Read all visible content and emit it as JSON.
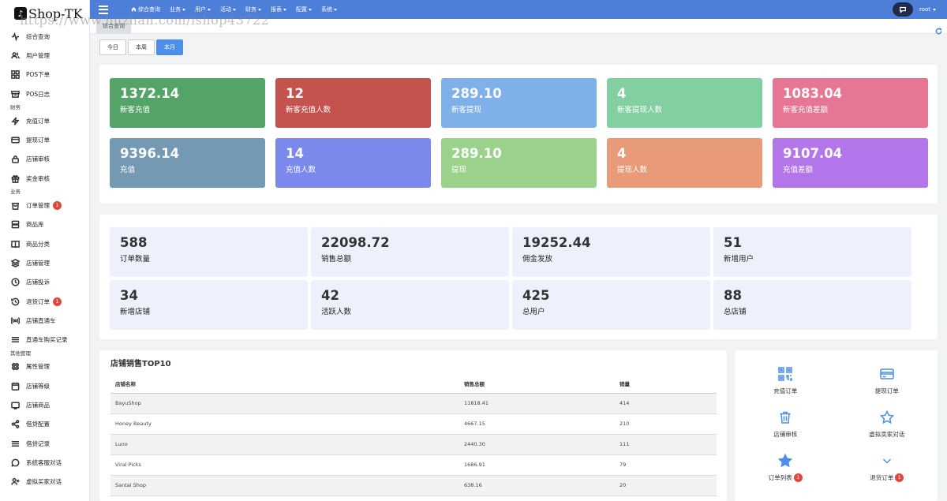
{
  "brand": {
    "name": "Shop-TK"
  },
  "watermark": "https://www.huzhan.com/ishop43722",
  "sidebar": {
    "top_items": [
      {
        "label": "综合查询",
        "icon": "activity-icon"
      },
      {
        "label": "用户管理",
        "icon": "users-icon"
      },
      {
        "label": "POS下单",
        "icon": "grid-icon"
      },
      {
        "label": "POS日志",
        "icon": "archive-icon"
      }
    ],
    "groups": [
      {
        "title": "财务",
        "items": [
          {
            "label": "充值订单",
            "icon": "lightning-icon"
          },
          {
            "label": "提现订单",
            "icon": "card-icon"
          },
          {
            "label": "店铺审核",
            "icon": "lock-icon"
          },
          {
            "label": "奖金审核",
            "icon": "gift-icon"
          }
        ]
      },
      {
        "title": "业务",
        "items": [
          {
            "label": "订单管理",
            "icon": "bag-icon",
            "badge": "1"
          },
          {
            "label": "商品库",
            "icon": "server-icon"
          },
          {
            "label": "商品分类",
            "icon": "book-icon"
          },
          {
            "label": "店铺管理",
            "icon": "layers-icon"
          },
          {
            "label": "店铺投诉",
            "icon": "clock-icon"
          },
          {
            "label": "退货订单",
            "icon": "history-icon",
            "badge": "1"
          },
          {
            "label": "店铺直通车",
            "icon": "broadcast-icon"
          },
          {
            "label": "直通车购买记录",
            "icon": "list-icon"
          }
        ]
      },
      {
        "title": "其他管理",
        "items": [
          {
            "label": "属性管理",
            "icon": "cpu-icon"
          },
          {
            "label": "店铺等级",
            "icon": "calendar-icon"
          },
          {
            "label": "店铺商品",
            "icon": "tv-icon"
          },
          {
            "label": "借贷配置",
            "icon": "share-icon"
          },
          {
            "label": "借贷记录",
            "icon": "menu-icon"
          },
          {
            "label": "系统客服对话",
            "icon": "message-icon"
          },
          {
            "label": "虚拟买家对话",
            "icon": "user-plus-icon"
          }
        ]
      }
    ]
  },
  "topbar": {
    "menus": [
      {
        "label": "综合查询",
        "icon": "home-icon",
        "dropdown": false
      },
      {
        "label": "业务",
        "dropdown": true
      },
      {
        "label": "用户",
        "dropdown": true
      },
      {
        "label": "活动",
        "dropdown": true
      },
      {
        "label": "财务",
        "dropdown": true
      },
      {
        "label": "报表",
        "dropdown": true
      },
      {
        "label": "配置",
        "dropdown": true
      },
      {
        "label": "系统",
        "dropdown": true
      }
    ],
    "user": "root"
  },
  "page_tab": "综合查询",
  "period_buttons": [
    {
      "label": "今日",
      "active": false
    },
    {
      "label": "本周",
      "active": false
    },
    {
      "label": "本月",
      "active": true
    }
  ],
  "colored_stats": [
    {
      "value": "1372.14",
      "label": "新客充值",
      "color": "#53a466"
    },
    {
      "value": "12",
      "label": "新客充值人数",
      "color": "#c6524e"
    },
    {
      "value": "289.10",
      "label": "新客提现",
      "color": "#7fb0ea"
    },
    {
      "value": "4",
      "label": "新客提现人数",
      "color": "#82cfa1"
    },
    {
      "value": "1083.04",
      "label": "新客充值差额",
      "color": "#e67693"
    },
    {
      "value": "9396.14",
      "label": "充值",
      "color": "#7399b3"
    },
    {
      "value": "14",
      "label": "充值人数",
      "color": "#7b89ec"
    },
    {
      "value": "289.10",
      "label": "提现",
      "color": "#9bd28b"
    },
    {
      "value": "4",
      "label": "提现人数",
      "color": "#e99a79"
    },
    {
      "value": "9107.04",
      "label": "充值差额",
      "color": "#b276ea"
    }
  ],
  "summary_stats": [
    {
      "value": "588",
      "label": "订单数量"
    },
    {
      "value": "22098.72",
      "label": "销售总额"
    },
    {
      "value": "19252.44",
      "label": "佣金发放"
    },
    {
      "value": "51",
      "label": "新增用户"
    },
    {
      "value": "34",
      "label": "新增店铺"
    },
    {
      "value": "42",
      "label": "活跃人数"
    },
    {
      "value": "425",
      "label": "总用户"
    },
    {
      "value": "88",
      "label": "总店铺"
    }
  ],
  "top_shops": {
    "title": "店铺销售TOP10",
    "columns": [
      "店铺名称",
      "销售总额",
      "销量"
    ],
    "rows": [
      [
        "BayuShop",
        "11818.41",
        "414"
      ],
      [
        "Honey Beauty",
        "4667.15",
        "210"
      ],
      [
        "Luno",
        "2440.30",
        "111"
      ],
      [
        "Viral Picks",
        "1686.91",
        "79"
      ],
      [
        "Santai Shop",
        "638.16",
        "20"
      ]
    ]
  },
  "quick_links": [
    {
      "label": "充值订单",
      "icon": "qr-icon"
    },
    {
      "label": "提现订单",
      "icon": "credit-card-icon"
    },
    {
      "label": "店铺审核",
      "icon": "trash-icon"
    },
    {
      "label": "虚拟卖家对话",
      "icon": "star-outline-icon"
    },
    {
      "label": "订单列表",
      "icon": "star-filled-icon",
      "badge": "1"
    },
    {
      "label": "退货订单",
      "icon": "chevron-down-icon",
      "badge": "1"
    }
  ]
}
